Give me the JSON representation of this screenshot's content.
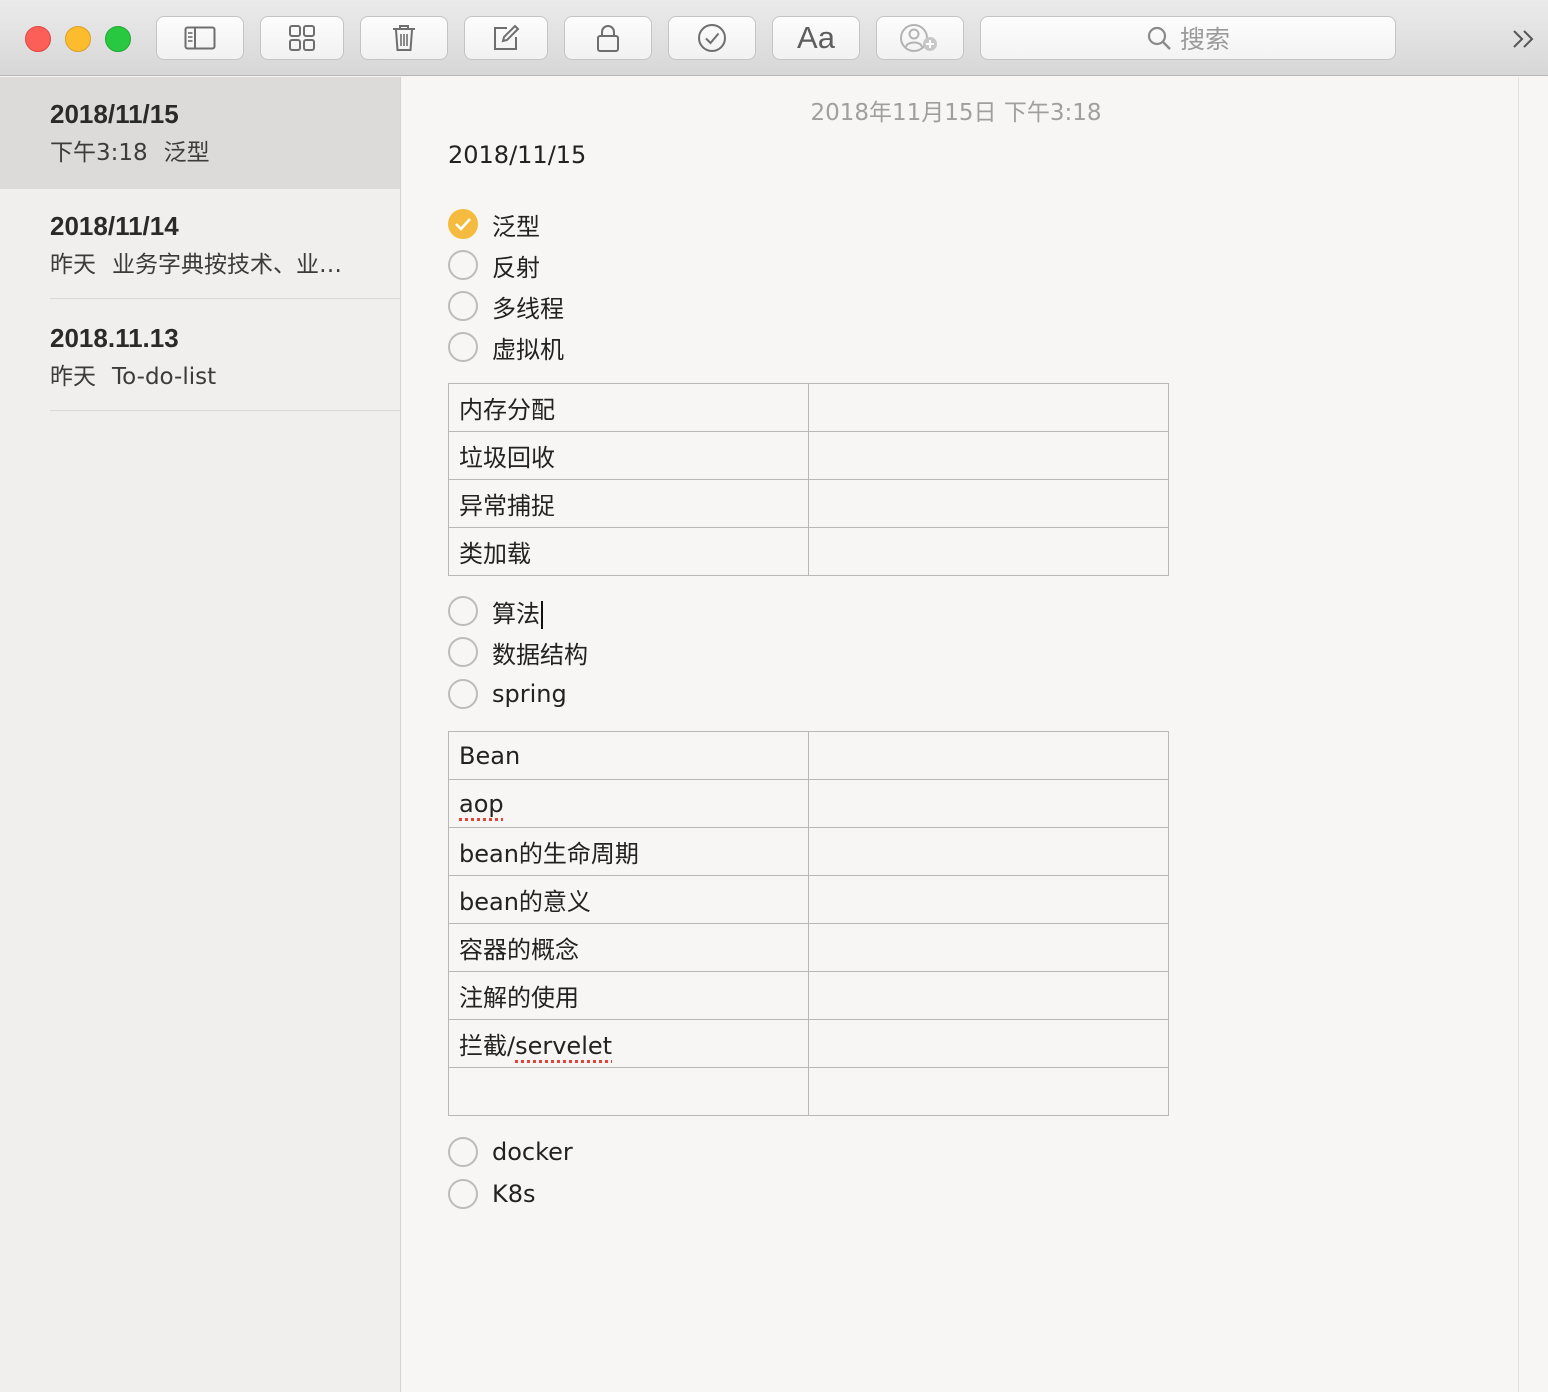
{
  "toolbar": {
    "search_placeholder": "搜索",
    "format_label": "Aa",
    "buttons": [
      "sidebar-toggle",
      "gallery-view",
      "delete",
      "compose",
      "lock",
      "checklist",
      "format",
      "add-people"
    ]
  },
  "sidebar": {
    "notes": [
      {
        "title": "2018/11/15",
        "time": "下午3:18",
        "preview": "泛型",
        "selected": true
      },
      {
        "title": "2018/11/14",
        "time": "昨天",
        "preview": "业务字典按技术、业…",
        "selected": false
      },
      {
        "title": "2018.11.13",
        "time": "昨天",
        "preview": "To-do-list",
        "selected": false
      }
    ]
  },
  "editor": {
    "timestamp": "2018年11月15日 下午3:18",
    "heading": "2018/11/15",
    "checklist_1": [
      {
        "label": "泛型",
        "checked": true
      },
      {
        "label": "反射",
        "checked": false
      },
      {
        "label": "多线程",
        "checked": false
      },
      {
        "label": "虚拟机",
        "checked": false
      }
    ],
    "table_1": [
      [
        "内存分配",
        ""
      ],
      [
        "垃圾回收",
        ""
      ],
      [
        "异常捕捉",
        ""
      ],
      [
        "类加载",
        ""
      ]
    ],
    "checklist_2": [
      {
        "label": "算法",
        "checked": false
      },
      {
        "label": "数据结构",
        "checked": false
      },
      {
        "label": "spring",
        "checked": false
      }
    ],
    "table_2": [
      [
        "Bean",
        ""
      ],
      [
        "aop",
        ""
      ],
      [
        "bean的生命周期",
        ""
      ],
      [
        "bean的意义",
        ""
      ],
      [
        "容器的概念",
        ""
      ],
      [
        "注解的使用",
        ""
      ],
      [
        "拦截/servelet",
        ""
      ],
      [
        "",
        ""
      ]
    ],
    "checklist_3": [
      {
        "label": "docker",
        "checked": false
      },
      {
        "label": "K8s",
        "checked": false
      }
    ]
  },
  "colors": {
    "accent_check": "#f4bb3e",
    "selected_row": "#dcdbd9",
    "spellcheck": "#e0453a"
  }
}
